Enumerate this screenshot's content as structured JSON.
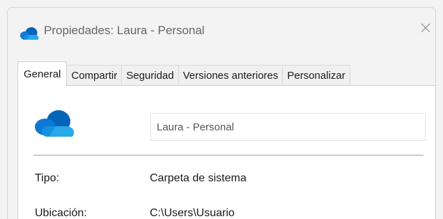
{
  "window": {
    "title": "Propiedades: Laura - Personal",
    "close_icon": "close-icon",
    "app_icon": "onedrive-cloud-icon"
  },
  "tabs": [
    {
      "label": "General",
      "active": true
    },
    {
      "label": "Compartir",
      "active": false
    },
    {
      "label": "Seguridad",
      "active": false
    },
    {
      "label": "Versiones anteriores",
      "active": false
    },
    {
      "label": "Personalizar",
      "active": false
    }
  ],
  "general": {
    "folder_icon": "onedrive-cloud-icon",
    "name_value": "Laura - Personal",
    "properties": [
      {
        "label": "Tipo:",
        "value": "Carpeta de sistema"
      },
      {
        "label": "Ubicación:",
        "value": "C:\\Users\\Usuario"
      }
    ]
  },
  "colors": {
    "accent_dark": "#0364b8",
    "accent_mid": "#0f78d4",
    "accent_light": "#28a8ea",
    "window_bg": "#f3f3f3",
    "panel_bg": "#ffffff"
  }
}
